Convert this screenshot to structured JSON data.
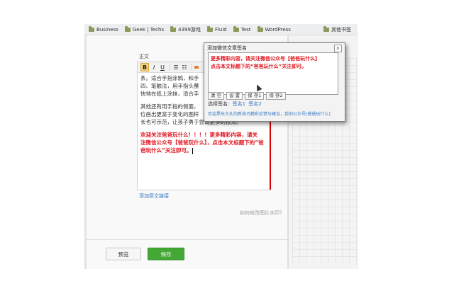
{
  "bookmarks": {
    "items": [
      {
        "label": "Business"
      },
      {
        "label": "Geek | Techs"
      },
      {
        "label": "4399游戏"
      },
      {
        "label": "Fluid"
      },
      {
        "label": "Test"
      },
      {
        "label": "WordPress"
      }
    ],
    "other_label": "其他书签"
  },
  "editor": {
    "section_label": "正文",
    "paragraphs": [
      "条。适合手指涂鸦，和手",
      "四、笔触法，用手指头蘸",
      "快地在纸上涂抹，适合手",
      "其他还有用手指的侧面，",
      "位画出更富于变化的图样",
      "长也可示范，让孩子勇于尝试更多的技法。"
    ],
    "red_lines": [
      "欢迎关注爸爸玩什么！！！！更多精彩内容，请关",
      "注微信公众号【爸爸玩什么】，点击本文标题下的“爸",
      "爸玩什么”关注即可。"
    ],
    "add_link_label": "添加原文链接",
    "watermark_link": "如何修改图片水印？"
  },
  "actions": {
    "preview_label": "预览",
    "save_label": "保存"
  },
  "popup": {
    "title": "添加微信文章签名",
    "close_label": "x",
    "text_line1": "更多精彩内容，请关注微信公众号【爸爸玩什么】",
    "text_line2": "点击本文标题下的“爸爸玩什么”关注即可。",
    "buttons": [
      {
        "label": "清 空"
      },
      {
        "label": "设 置"
      },
      {
        "label": "保 存1"
      },
      {
        "label": "保 存2"
      }
    ],
    "signature_label": "选择签名:",
    "signature1": "签名1",
    "signature2": "签名2",
    "footer": "欢迎黑东方孔的新技巧精彩反馈与建议，我的公众号[爸爸玩什么]"
  },
  "colors": {
    "accent_red": "#e0141e",
    "save_green": "#44a837",
    "link_blue": "#3478c3"
  }
}
